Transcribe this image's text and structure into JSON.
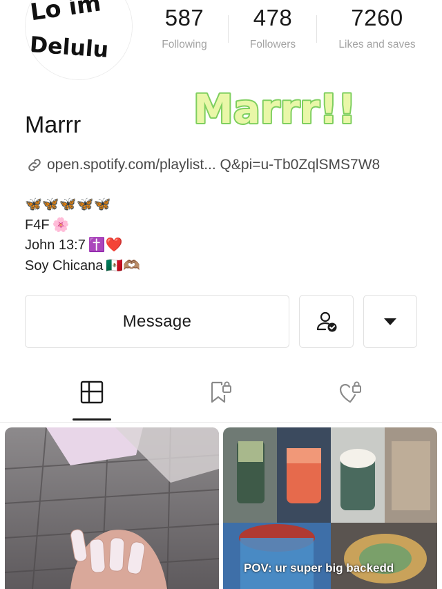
{
  "profile": {
    "avatar_text_top": "Lo  im",
    "avatar_text_bottom": "Delulu",
    "name": "Marrr",
    "bubble_text": "Marrr!!!",
    "link": "open.spotify.com/playlist... Q&pi=u-Tb0ZqlSMS7W8"
  },
  "stats": {
    "following": {
      "value": "587",
      "label": "Following"
    },
    "followers": {
      "value": "478",
      "label": "Followers"
    },
    "likes": {
      "value": "7260",
      "label": "Likes and saves"
    }
  },
  "bio": {
    "line1": "🦋🦋🦋🦋🦋",
    "line2_text": "F4F",
    "line2_emoji": "🌸",
    "line3_text": "John 13:7",
    "line3_emoji": "✝️❤️",
    "line4_text": "Soy Chicana",
    "line4_emoji": "🇲🇽🫶🏽"
  },
  "actions": {
    "message_label": "Message",
    "follow_icon": "person-check-icon",
    "more_icon": "caret-down-icon"
  },
  "tabs": [
    {
      "name": "posts",
      "icon": "grid-icon",
      "active": true
    },
    {
      "name": "saved",
      "icon": "bookmark-lock-icon",
      "active": false
    },
    {
      "name": "liked",
      "icon": "heart-lock-icon",
      "active": false
    }
  ],
  "posts": [
    {
      "overlay": ""
    },
    {
      "overlay": "POV: ur super big backedd"
    }
  ],
  "colors": {
    "bubble_fill": "#e9f7a8",
    "bubble_outline": "#7fcf5f",
    "divider": "#e3e3e3",
    "muted_text": "#a3a3a3"
  }
}
